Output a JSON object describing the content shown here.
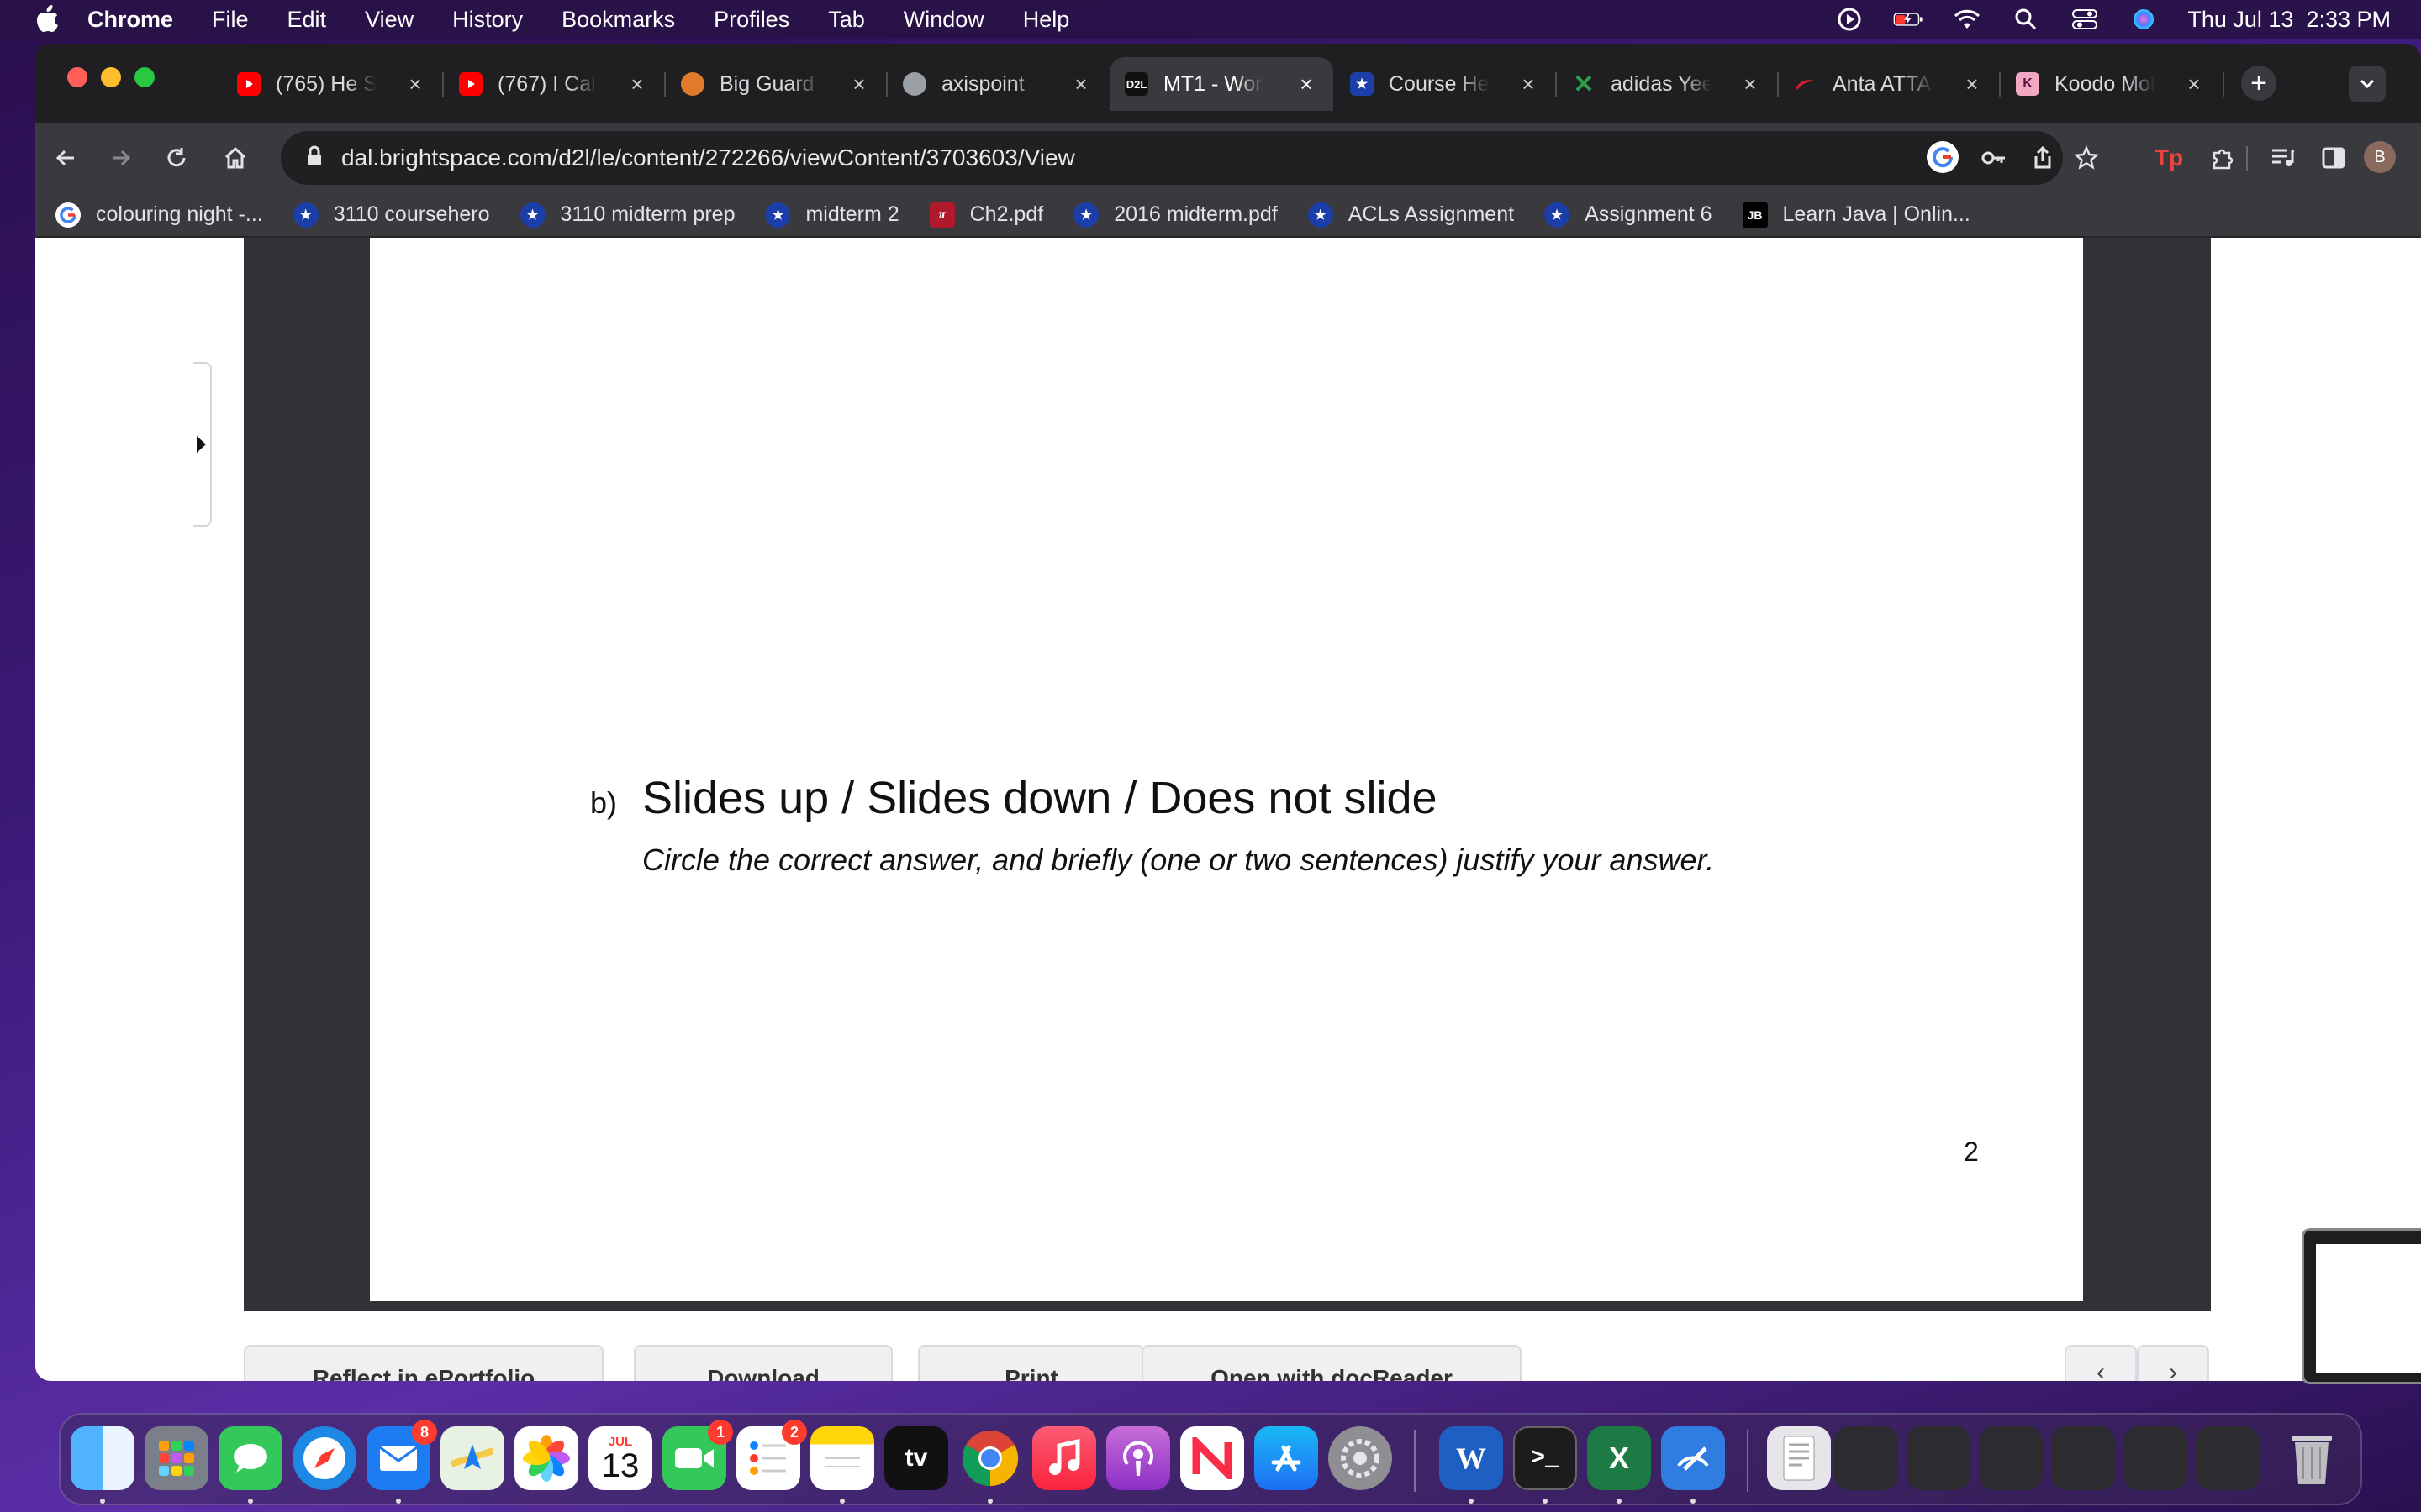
{
  "menubar": {
    "app_name": "Chrome",
    "items": [
      "File",
      "Edit",
      "View",
      "History",
      "Bookmarks",
      "Profiles",
      "Tab",
      "Window",
      "Help"
    ],
    "clock": "Thu Jul 13  2:33 PM"
  },
  "tabs": [
    {
      "title": "(765) He S",
      "favicon": "youtube-icon"
    },
    {
      "title": "(767) I Call",
      "favicon": "youtube-icon"
    },
    {
      "title": "Big Guard",
      "favicon": "basketball-icon"
    },
    {
      "title": "axispoint",
      "favicon": "globe-icon"
    },
    {
      "title": "MT1 - Worl",
      "favicon": "d2l-icon",
      "favicon_text": "D2L",
      "active": true
    },
    {
      "title": "Course He",
      "favicon": "star-icon"
    },
    {
      "title": "adidas Yee",
      "favicon": "x-brand-icon"
    },
    {
      "title": "Anta ATTA",
      "favicon": "anta-icon"
    },
    {
      "title": "Koodo Mol",
      "favicon": "koodo-icon",
      "favicon_text": "K"
    }
  ],
  "toolbar": {
    "url": "dal.brightspace.com/d2l/le/content/272266/viewContent/3703603/View",
    "profile_initial": "B"
  },
  "bookmarks": [
    {
      "label": "colouring night -...",
      "icon": "google-icon"
    },
    {
      "label": "3110 coursehero",
      "icon": "star-icon"
    },
    {
      "label": "3110 midterm prep",
      "icon": "star-icon"
    },
    {
      "label": "midterm 2",
      "icon": "star-icon"
    },
    {
      "label": "Ch2.pdf",
      "icon": "pdf-icon"
    },
    {
      "label": "2016 midterm.pdf",
      "icon": "star-icon"
    },
    {
      "label": "ACLs Assignment",
      "icon": "star-icon"
    },
    {
      "label": "Assignment 6",
      "icon": "star-icon"
    },
    {
      "label": "Learn Java | Onlin...",
      "icon": "jetbrains-icon",
      "icon_text": "JB"
    }
  ],
  "document": {
    "question_label": "b)",
    "options_text": "Slides up / Slides down / Does not slide",
    "instruction": "Circle the correct answer, and briefly (one or two sentences) justify your answer.",
    "page_number": "2"
  },
  "actions": [
    {
      "label": "Reflect in ePortfolio"
    },
    {
      "label": "Download"
    },
    {
      "label": "Print"
    },
    {
      "label": "Open with docReader"
    }
  ],
  "dock": {
    "calendar_month": "JUL",
    "calendar_day": "13",
    "mail_badge": "8",
    "facetime_badge": "1",
    "reminders_badge": "2",
    "tv_label": "tv"
  },
  "colors": {
    "accent_red": "#ff3b30",
    "chrome_dark": "#3a3a3e",
    "viewer_gray": "#323236"
  }
}
